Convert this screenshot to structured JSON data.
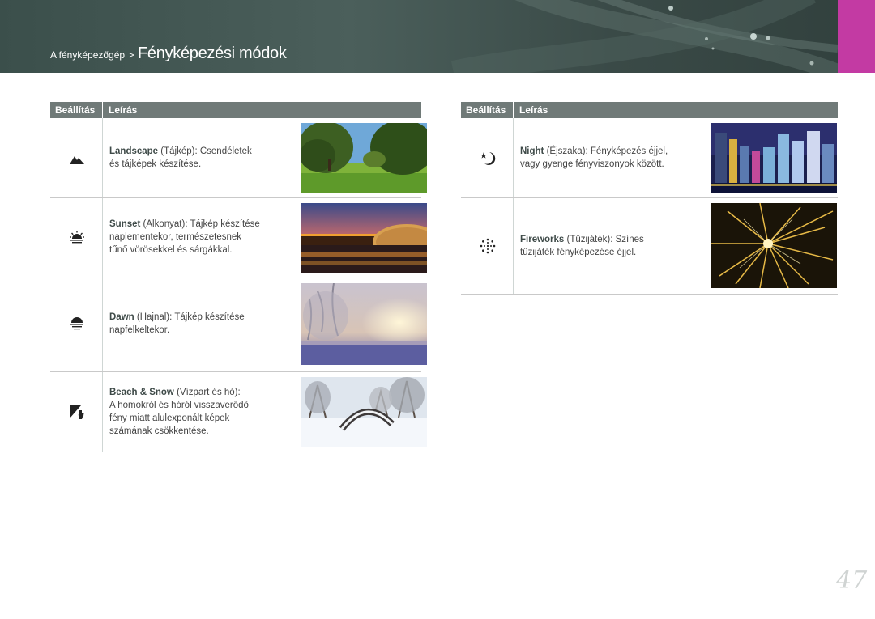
{
  "header": {
    "breadcrumb_parent": "A fényképezőgép",
    "breadcrumb_separator": ">",
    "title": "Fényképezési módok"
  },
  "left_table": {
    "col_setting": "Beállítás",
    "col_description": "Leírás",
    "rows": [
      {
        "icon": "landscape-icon",
        "name": "Landscape",
        "lines": [
          "(Tájkép): Csendéletek",
          "és tájképek készítése."
        ]
      },
      {
        "icon": "sunset-icon",
        "name": "Sunset",
        "lines": [
          "(Alkonyat): Tájkép készítése",
          "naplementekor, természetesnek",
          "tűnő vörösekkel és sárgákkal."
        ]
      },
      {
        "icon": "dawn-icon",
        "name": "Dawn",
        "lines": [
          "(Hajnal): Tájkép készítése",
          "napfelkeltekor."
        ]
      },
      {
        "icon": "beach-snow-icon",
        "name": "Beach & Snow",
        "lines": [
          "(Vízpart és hó):",
          "A homokról és hóról visszaverődő",
          "fény miatt alulexponált képek",
          "számának csökkentése."
        ]
      }
    ]
  },
  "right_table": {
    "col_setting": "Beállítás",
    "col_description": "Leírás",
    "rows": [
      {
        "icon": "night-icon",
        "name": "Night",
        "lines": [
          "(Éjszaka): Fényképezés éjjel,",
          "vagy gyenge fényviszonyok között."
        ]
      },
      {
        "icon": "fireworks-icon",
        "name": "Fireworks",
        "lines": [
          "(Tűzijáték): Színes",
          "tűzijáték fényképezése éjjel."
        ]
      }
    ]
  },
  "page_number": "47"
}
